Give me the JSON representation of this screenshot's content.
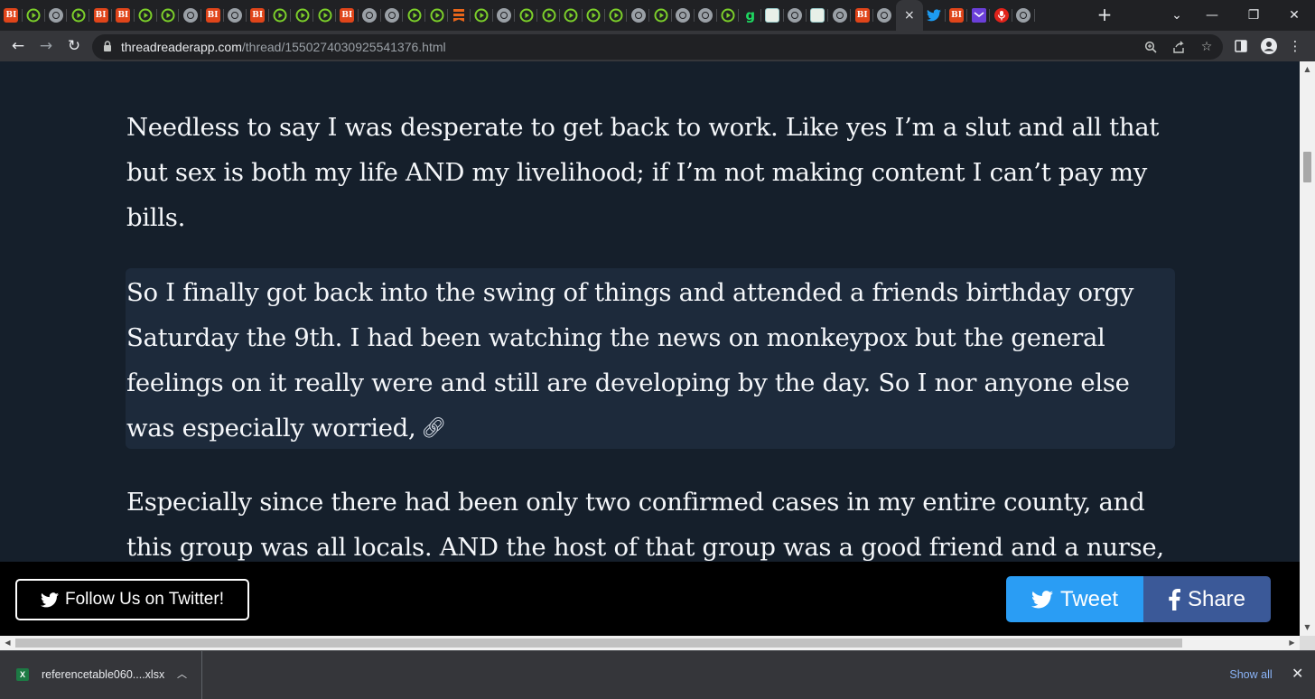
{
  "browser": {
    "tab_favicons": [
      "bi",
      "play",
      "globe",
      "play",
      "bi",
      "bi",
      "play",
      "play",
      "globe",
      "bi",
      "globe",
      "bi",
      "play",
      "play",
      "play",
      "bi",
      "globe",
      "globe",
      "play",
      "play",
      "bookmark",
      "play",
      "globe",
      "play",
      "play",
      "play",
      "play",
      "play",
      "globe",
      "play",
      "globe",
      "globe",
      "play",
      "g",
      "tile",
      "globe",
      "tile",
      "globe",
      "bi",
      "globe",
      "active",
      "twitter",
      "bi",
      "mail",
      "podcast",
      "globe"
    ],
    "new_tab_label": "+",
    "close_tab_label": "×",
    "url_host": "threadreaderapp.com",
    "url_path": "/thread/1550274030925541376.html"
  },
  "thread": {
    "paragraphs": [
      "Needless to say I was desperate to get back to work. Like yes I’m a slut and all that but sex is both my life AND my livelihood; if I’m not making content I can’t pay my bills.",
      "So I finally got back into the swing of things and attended a friends birthday orgy Saturday the 9th. I had been watching the news on monkeypox but the general feelings on it really were and still are developing by the day. So I nor anyone else was especially worried,",
      "Especially since there had been only two confirmed cases in my entire county, and this group was all locals. AND the host of that group was a good friend and a nurse,"
    ]
  },
  "share_bar": {
    "follow_label": "Follow Us on Twitter!",
    "tweet_label": "Tweet",
    "share_label": "Share",
    "tweet_color": "#2a9df4",
    "share_color": "#3b5998"
  },
  "downloads": {
    "file_name": "referencetable060....xlsx",
    "file_icon_letter": "X",
    "show_all_label": "Show all"
  }
}
